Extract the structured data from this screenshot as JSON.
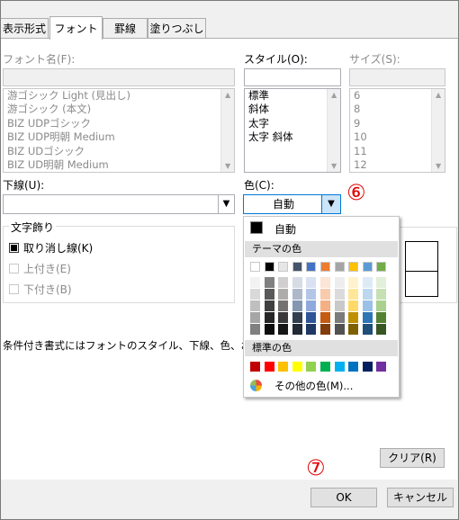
{
  "tabs": [
    "表示形式",
    "フォント",
    "罫線",
    "塗りつぶし"
  ],
  "active_tab": "フォント",
  "labels": {
    "font_name": "フォント名(F):",
    "style": "スタイル(O):",
    "size": "サイズ(S):",
    "underline": "下線(U):",
    "color": "色(C):",
    "effects_group": "文字飾り"
  },
  "font_list": [
    "游ゴシック Light (見出し)",
    "游ゴシック (本文)",
    "BIZ UDPゴシック",
    "BIZ UDP明朝 Medium",
    "BIZ UDゴシック",
    "BIZ UD明朝 Medium"
  ],
  "style_list": [
    "標準",
    "斜体",
    "太字",
    "太字 斜体"
  ],
  "size_list": [
    "6",
    "8",
    "9",
    "10",
    "11",
    "12"
  ],
  "color_value": "自動",
  "effects": [
    {
      "label": "取り消し線(K)",
      "checked": true,
      "disabled": false
    },
    {
      "label": "上付き(E)",
      "checked": false,
      "disabled": true
    },
    {
      "label": "下付き(B)",
      "checked": false,
      "disabled": true
    }
  ],
  "info_text": "条件付き書式にはフォントのスタイル、下線、色、および取り",
  "palette": {
    "auto_label": "自動",
    "theme_header": "テーマの色",
    "standard_header": "標準の色",
    "more_colors": "その他の色(M)...",
    "theme_colors": [
      "#ffffff",
      "#000000",
      "#e7e6e6",
      "#44546a",
      "#4472c4",
      "#ed7d31",
      "#a5a5a5",
      "#ffc000",
      "#5b9bd5",
      "#70ad47"
    ],
    "theme_tints": [
      [
        "#f2f2f2",
        "#d9d9d9",
        "#bfbfbf",
        "#a6a6a6",
        "#808080"
      ],
      [
        "#808080",
        "#595959",
        "#404040",
        "#262626",
        "#0d0d0d"
      ],
      [
        "#d0cece",
        "#aeabab",
        "#757171",
        "#3a3838",
        "#171616"
      ],
      [
        "#d6dce4",
        "#adb9ca",
        "#8497b0",
        "#333f4f",
        "#222a35"
      ],
      [
        "#d9e1f2",
        "#b4c6e7",
        "#8ea9db",
        "#2f5597",
        "#1f3864"
      ],
      [
        "#fce4d6",
        "#f8cbad",
        "#f4b084",
        "#c55a11",
        "#833c0b"
      ],
      [
        "#ededed",
        "#dbdbdb",
        "#c9c9c9",
        "#7b7b7b",
        "#525252"
      ],
      [
        "#fff2cc",
        "#ffe699",
        "#ffd966",
        "#bf8f00",
        "#7f6000"
      ],
      [
        "#ddebf7",
        "#bdd7ee",
        "#9bc2e6",
        "#2e75b6",
        "#1f4e78"
      ],
      [
        "#e2efda",
        "#c6e0b4",
        "#a9d08e",
        "#548235",
        "#375623"
      ]
    ],
    "standard_colors": [
      "#c00000",
      "#ff0000",
      "#ffc000",
      "#ffff00",
      "#92d050",
      "#00b050",
      "#00b0f0",
      "#0070c0",
      "#002060",
      "#7030a0"
    ]
  },
  "buttons": {
    "clear": "クリア(R)",
    "ok": "OK",
    "cancel": "キャンセル"
  },
  "annotations": {
    "step6": "⑥",
    "step7": "⑦"
  }
}
